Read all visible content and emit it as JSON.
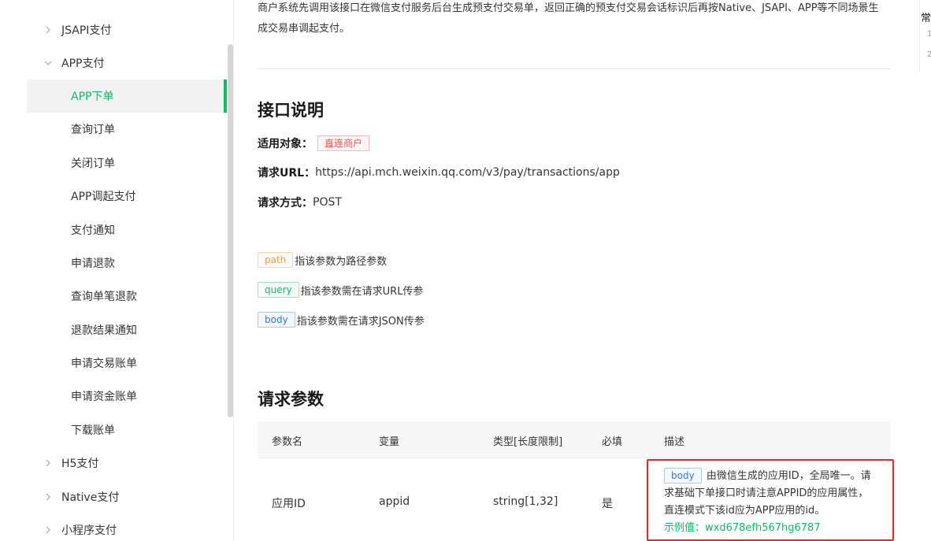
{
  "sidebar": {
    "items": [
      {
        "label": "JSAPI支付"
      },
      {
        "label": "APP支付"
      },
      {
        "label": "APP下单"
      },
      {
        "label": "查询订单"
      },
      {
        "label": "关闭订单"
      },
      {
        "label": "APP调起支付"
      },
      {
        "label": "支付通知"
      },
      {
        "label": "申请退款"
      },
      {
        "label": "查询单笔退款"
      },
      {
        "label": "退款结果通知"
      },
      {
        "label": "申请交易账单"
      },
      {
        "label": "申请资金账单"
      },
      {
        "label": "下载账单"
      },
      {
        "label": "H5支付"
      },
      {
        "label": "Native支付"
      },
      {
        "label": "小程序支付"
      }
    ],
    "active_index": 2,
    "accent_color": "#07c160"
  },
  "main": {
    "intro": "商户系统先调用该接口在微信支付服务后台生成预支付交易单，返回正确的预支付交易会话标识后再按Native、JSAPI、APP等不同场景生成交易串调起支付。",
    "api_section": {
      "title": "接口说明",
      "applicable_label": "适用对象：",
      "applicable_tag": "直连商户",
      "url_label": "请求URL：",
      "url_value": "https://api.mch.weixin.qq.com/v3/pay/transactions/app",
      "method_label": "请求方式：",
      "method_value": "POST"
    },
    "param_legend": [
      {
        "tag": "path",
        "text": "指该参数为路径参数"
      },
      {
        "tag": "query",
        "text": "指该参数需在请求URL传参"
      },
      {
        "tag": "body",
        "text": "指该参数需在请求JSON传参"
      }
    ],
    "params_section": {
      "title": "请求参数",
      "columns": [
        "参数名",
        "变量",
        "类型[长度限制]",
        "必填",
        "描述"
      ],
      "rows": [
        {
          "name": "应用ID",
          "variable": "appid",
          "type": "string[1,32]",
          "required": "是",
          "desc_tag": "body",
          "desc_text": "由微信生成的应用ID，全局唯一。请求基础下单接口时请注意APPID的应用属性，直连模式下该id应为APP应用的id。",
          "example": "示例值：wxd678efh567hg6787"
        }
      ]
    }
  },
  "right_panel": {
    "heading": "常",
    "n1": "1",
    "n2": "2"
  }
}
